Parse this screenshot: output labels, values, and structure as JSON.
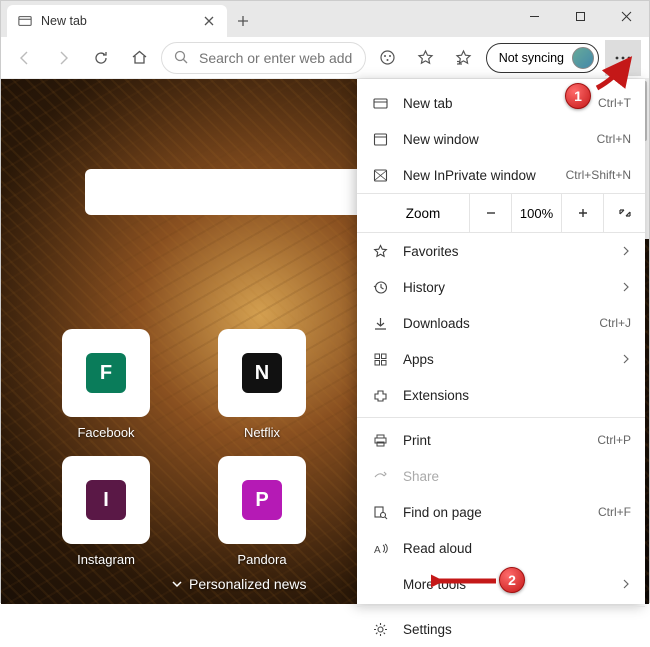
{
  "window": {
    "tab_title": "New tab",
    "minimize": "minimize",
    "maximize": "maximize",
    "close": "close"
  },
  "toolbar": {
    "sync_label": "Not syncing",
    "search_placeholder": "Search or enter web address"
  },
  "ntp": {
    "tiles": [
      {
        "letter": "F",
        "label": "Facebook",
        "color": "#0a7c5a"
      },
      {
        "letter": "N",
        "label": "Netflix",
        "color": "#111111"
      },
      {
        "letter": "I",
        "label": "Instagram",
        "color": "#5a1846"
      },
      {
        "letter": "P",
        "label": "Pandora",
        "color": "#b51ab5"
      }
    ],
    "personalize": "Personalized news"
  },
  "menu": {
    "new_tab": {
      "label": "New tab",
      "shortcut": "Ctrl+T"
    },
    "new_window": {
      "label": "New window",
      "shortcut": "Ctrl+N"
    },
    "new_inprivate": {
      "label": "New InPrivate window",
      "shortcut": "Ctrl+Shift+N"
    },
    "zoom": {
      "label": "Zoom",
      "value": "100%"
    },
    "favorites": {
      "label": "Favorites"
    },
    "history": {
      "label": "History"
    },
    "downloads": {
      "label": "Downloads",
      "shortcut": "Ctrl+J"
    },
    "apps": {
      "label": "Apps"
    },
    "extensions": {
      "label": "Extensions"
    },
    "print": {
      "label": "Print",
      "shortcut": "Ctrl+P"
    },
    "share": {
      "label": "Share"
    },
    "find": {
      "label": "Find on page",
      "shortcut": "Ctrl+F"
    },
    "read_aloud": {
      "label": "Read aloud"
    },
    "more_tools": {
      "label": "More tools"
    },
    "settings": {
      "label": "Settings"
    }
  },
  "callouts": {
    "one": "1",
    "two": "2"
  }
}
